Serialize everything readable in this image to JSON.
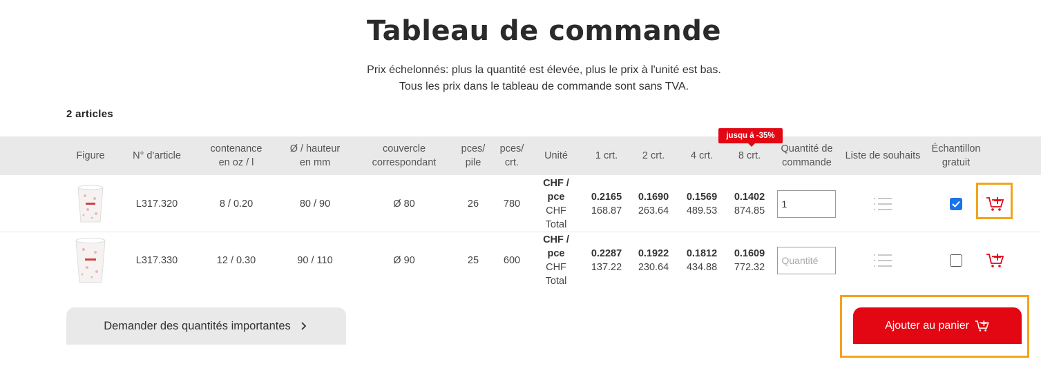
{
  "page": {
    "title": "Tableau de commande",
    "subtitle1": "Prix échelonnés: plus la quantité est élevée, plus le prix à l'unité est bas.",
    "subtitle2": "Tous les prix dans le tableau de commande sont sans TVA.",
    "article_count": "2 articles"
  },
  "table": {
    "headers": {
      "figure": "Figure",
      "article_no": "N° d'article",
      "capacity_1": "contenance",
      "capacity_2": "en oz / l",
      "size_1": "Ø / hauteur",
      "size_2": "en mm",
      "lid_1": "couvercle",
      "lid_2": "correspondant",
      "pcs_stack_1": "pces/",
      "pcs_stack_2": "pile",
      "pcs_carton_1": "pces/",
      "pcs_carton_2": "crt.",
      "unit": "Unité",
      "tier1": "1 crt.",
      "tier2": "2 crt.",
      "tier4": "4 crt.",
      "tier8": "8 crt.",
      "quantity_1": "Quantité de",
      "quantity_2": "commande",
      "wishlist": "Liste de souhaits",
      "sample_1": "Échantillon",
      "sample_2": "gratuit"
    },
    "discount_badge": "jusqu á -35%",
    "rows": [
      {
        "article": "L317.320",
        "capacity": "8 / 0.20",
        "size": "80 / 90",
        "lid": "Ø 80",
        "pcs_stack": "26",
        "pcs_carton": "780",
        "unit_a": "CHF /",
        "unit_b": "pce",
        "unit_c": "CHF",
        "unit_d": "Total",
        "p1_unit": "0.2165",
        "p1_total": "168.87",
        "p2_unit": "0.1690",
        "p2_total": "263.64",
        "p4_unit": "0.1569",
        "p4_total": "489.53",
        "p8_unit": "0.1402",
        "p8_total": "874.85",
        "quantity": "1",
        "sample_checked": true
      },
      {
        "article": "L317.330",
        "capacity": "12 / 0.30",
        "size": "90 / 110",
        "lid": "Ø 90",
        "pcs_stack": "25",
        "pcs_carton": "600",
        "unit_a": "CHF /",
        "unit_b": "pce",
        "unit_c": "CHF",
        "unit_d": "Total",
        "p1_unit": "0.2287",
        "p1_total": "137.22",
        "p2_unit": "0.1922",
        "p2_total": "230.64",
        "p4_unit": "0.1812",
        "p4_total": "434.88",
        "p8_unit": "0.1609",
        "p8_total": "772.32",
        "quantity": "",
        "quantity_placeholder": "Quantité",
        "sample_checked": false
      }
    ]
  },
  "buttons": {
    "request_large": "Demander des quantités importantes",
    "add_to_cart": "Ajouter au panier"
  },
  "colors": {
    "accent": "#e30613",
    "highlight": "#f2a31b",
    "header_bg": "#e9e9e9"
  },
  "icons": [
    "chevron-right-icon",
    "cart-plus-icon",
    "list-icon",
    "check-icon"
  ]
}
